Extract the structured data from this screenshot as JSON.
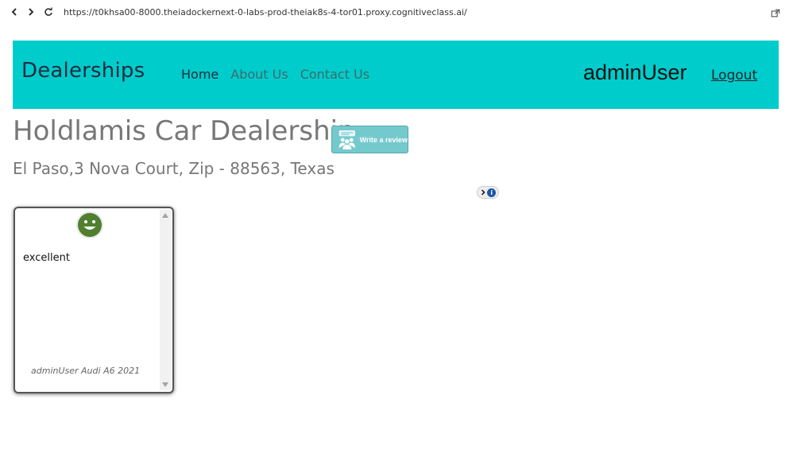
{
  "browser": {
    "url": "https://t0khsa00-8000.theiadockernext-0-labs-prod-theiak8s-4-tor01.proxy.cognitiveclass.ai/"
  },
  "navbar": {
    "brand": "Dealerships",
    "links": [
      {
        "label": "Home",
        "active": true
      },
      {
        "label": "About Us",
        "active": false
      },
      {
        "label": "Contact Us",
        "active": false
      }
    ],
    "username": "adminUser",
    "logout_label": "Logout",
    "background_color": "#00cccc"
  },
  "dealer": {
    "name": "Holdlamis Car Dealership",
    "address": "El Paso,3 Nova Court, Zip - 88563, Texas",
    "write_review_label": "Write a review"
  },
  "reviews": [
    {
      "sentiment": "positive",
      "sentiment_icon": "smiley-face-icon",
      "text": "excellent",
      "reviewer": "adminUser",
      "car": "Audi A6 2021",
      "meta": "adminUser Audi A6 2021"
    }
  ],
  "icons": {
    "back": "chevron-left-icon",
    "forward": "chevron-right-icon",
    "reload": "reload-icon",
    "open_external": "open-external-icon",
    "review_button": "people-group-icon",
    "extension": "password-manager-icon"
  }
}
